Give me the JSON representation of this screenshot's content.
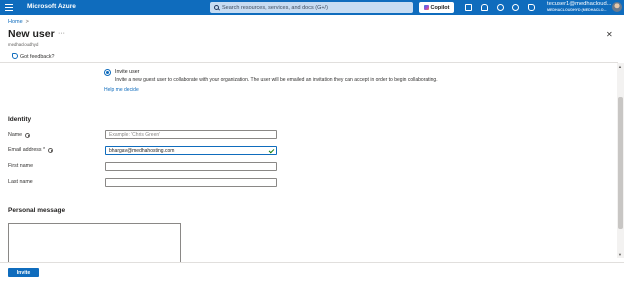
{
  "topbar": {
    "brand": "Microsoft Azure",
    "search_placeholder": "Search resources, services, and docs (G+/)",
    "copilot_label": "Copilot",
    "user_name": "tecuser1@medhacloud...",
    "user_tenant": "MEDHACLOUDHYD (MEDHACLO..."
  },
  "breadcrumb": {
    "home": "Home",
    "separator": ">"
  },
  "page": {
    "title": "New user",
    "more": "···",
    "tenant": "medhacloudhyd",
    "close": "✕"
  },
  "feedback": {
    "label": "Got feedback?"
  },
  "invite": {
    "option_label": "Invite user",
    "description": "Invite a new guest user to collaborate with your organization. The user will be emailed an invitation they can accept in order to begin collaborating.",
    "help_link": "Help me decide",
    "selected": true
  },
  "identity": {
    "section_title": "Identity",
    "fields": [
      {
        "label": "Name",
        "placeholder": "Example: 'Chris Green'",
        "value": "",
        "info": true
      },
      {
        "label": "Email address *",
        "placeholder": "",
        "value": "bhargav@medhahosting.com",
        "info": true,
        "valid": true
      },
      {
        "label": "First name",
        "placeholder": "",
        "value": "",
        "info": false
      },
      {
        "label": "Last name",
        "placeholder": "",
        "value": "",
        "info": false
      }
    ]
  },
  "personal_message": {
    "section_title": "Personal message",
    "value": ""
  },
  "footer": {
    "invite_button": "Invite"
  },
  "scrollbar": {
    "up": "▲",
    "down": "▼"
  },
  "colors": {
    "topbar": "#0f6cbd",
    "accent": "#0f6cbd",
    "valid": "#107c10"
  }
}
